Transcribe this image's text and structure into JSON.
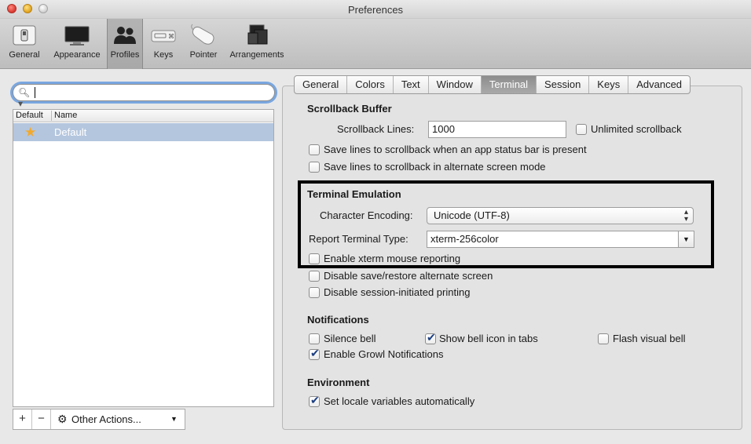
{
  "window": {
    "title": "Preferences"
  },
  "toolbar": {
    "items": [
      {
        "label": "General",
        "icon": "general-switch-icon"
      },
      {
        "label": "Appearance",
        "icon": "monitor-icon"
      },
      {
        "label": "Profiles",
        "icon": "profiles-people-icon"
      },
      {
        "label": "Keys",
        "icon": "keyboard-icon"
      },
      {
        "label": "Pointer",
        "icon": "mouse-icon"
      },
      {
        "label": "Arrangements",
        "icon": "windows-icon"
      }
    ],
    "selected": "Profiles"
  },
  "profiles": {
    "search_value": "",
    "columns": [
      "Default",
      "Name"
    ],
    "rows": [
      {
        "name": "Default",
        "is_default": true
      }
    ],
    "add_label": "+",
    "remove_label": "−",
    "actions_label": "Other Actions..."
  },
  "tabs": [
    "General",
    "Colors",
    "Text",
    "Window",
    "Terminal",
    "Session",
    "Keys",
    "Advanced"
  ],
  "active_tab": "Terminal",
  "scrollback": {
    "heading": "Scrollback Buffer",
    "lines_label": "Scrollback Lines:",
    "lines_value": "1000",
    "unlimited_label": "Unlimited scrollback",
    "unlimited_checked": false,
    "status_bar_label": "Save lines to scrollback when an app status bar is present",
    "status_bar_checked": false,
    "alt_screen_label": "Save lines to scrollback in alternate screen mode",
    "alt_screen_checked": false
  },
  "emulation": {
    "heading": "Terminal Emulation",
    "encoding_label": "Character Encoding:",
    "encoding_value": "Unicode (UTF-8)",
    "report_label": "Report Terminal Type:",
    "report_value": "xterm-256color",
    "mouse_label": "Enable xterm mouse reporting",
    "mouse_checked": false,
    "disable_save_label": "Disable save/restore alternate screen",
    "disable_save_checked": false,
    "disable_print_label": "Disable session-initiated printing",
    "disable_print_checked": false
  },
  "notifications": {
    "heading": "Notifications",
    "silence_label": "Silence bell",
    "silence_checked": false,
    "show_bell_label": "Show bell icon in tabs",
    "show_bell_checked": true,
    "flash_label": "Flash visual bell",
    "flash_checked": false,
    "growl_label": "Enable Growl Notifications",
    "growl_checked": true
  },
  "environment": {
    "heading": "Environment",
    "locale_label": "Set locale variables automatically",
    "locale_checked": true
  },
  "colors": {
    "selection_row": "#b4c6de",
    "active_tab": "#999999",
    "search_focus": "#7aa7e0"
  }
}
